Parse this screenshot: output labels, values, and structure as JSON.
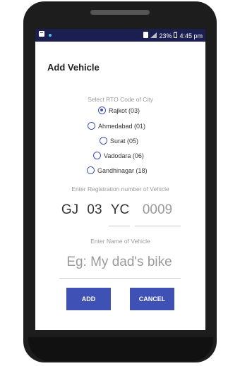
{
  "status_bar": {
    "left_icons": [
      "notification-icon",
      "dot-icon"
    ],
    "battery_percent": "23%",
    "time": "4:45 pm"
  },
  "dialog": {
    "title": "Add Vehicle",
    "rto_label": "Select RTO Code of City",
    "rto_options": [
      {
        "label": "Rajkot (03)",
        "selected": true
      },
      {
        "label": "Ahmedabad (01)",
        "selected": false
      },
      {
        "label": "Surat (05)",
        "selected": false
      },
      {
        "label": "Vadodara (06)",
        "selected": false
      },
      {
        "label": "Gandhinagar (18)",
        "selected": false
      }
    ],
    "registration_label": "Enter Registration number of Vehicle",
    "registration": {
      "state": "GJ",
      "rto_code": "03",
      "series": "YC",
      "number_placeholder": "0009"
    },
    "name_label": "Enter Name of Vehicle",
    "name_placeholder": "Eg: My dad's bike",
    "add_button": "ADD",
    "cancel_button": "CANCEL"
  },
  "colors": {
    "accent": "#3f51b5",
    "status_bar": "#1b1f4f"
  }
}
